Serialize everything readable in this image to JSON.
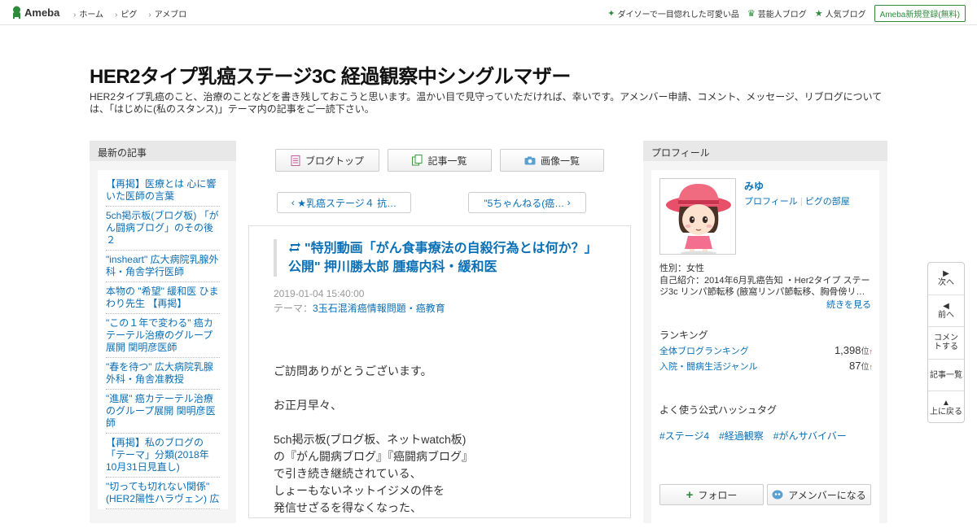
{
  "topbar": {
    "logo": "Ameba",
    "nav": [
      "ホーム",
      "ピグ",
      "アメブロ"
    ],
    "links": [
      {
        "icon": "sparkle-icon",
        "label": "ダイソーで一目惚れした可愛い品"
      },
      {
        "icon": "crown-icon",
        "label": "芸能人ブログ"
      },
      {
        "icon": "star-icon",
        "label": "人気ブログ"
      }
    ],
    "register": "Ameba新規登録(無料)"
  },
  "blog": {
    "title": "HER2タイプ乳癌ステージ3C 経過観察中シングルマザー",
    "description": "HER2タイプ乳癌のこと、治療のことなどを書き残しておこうと思います。温かい目で見守っていただければ、幸いです。アメンバー申請、コメント、メッセージ、リブログについては、「はじめに(私のスタンス)」テーマ内の記事をご一読下さい。"
  },
  "left": {
    "heading": "最新の記事",
    "items": [
      "【再掲】医療とは 心に響いた医師の言葉",
      "5ch掲示板(ブログ板) 「がん闘病ブログ」のその後２",
      "\"insheart\" 広大病院乳腺外科・角舎学行医師",
      "本物の \"希望\" 緩和医 ひまわり先生 【再掲】",
      "\"この１年で変わる\" 癌カテーテル治療のグループ展開 関明彦医師",
      "\"春を待つ\" 広大病院乳腺外科・角舎准教授",
      "\"進展\" 癌カテーテル治療のグループ展開 関明彦医師",
      "【再掲】私のブログの「テーマ」分類(2018年10月31日見直し)",
      "\"切っても切れない関係\" (HER2陽性ハラヴェン) 広"
    ]
  },
  "center": {
    "buttons": [
      "ブログトップ",
      "記事一覧",
      "画像一覧"
    ],
    "prev": "★乳癌ステージ４ 抗…",
    "next": "\"5ちゃんねる(癌…",
    "article": {
      "title": "\"特別動画「がん食事療法の自殺行為とは何か？」公開\" 押川勝太郎 腫瘍内科・緩和医",
      "date": "2019-01-04 15:40:00",
      "theme_label": "テーマ：",
      "theme": "3玉石混淆癌情報問題・癌教育",
      "body": [
        "ご訪問ありがとうございます。",
        "",
        "お正月早々、",
        "",
        "5ch掲示板(ブログ板、ネットwatch板)",
        "の『がん闘病ブログ』『癌闘病ブログ』",
        "で引き続き継続されている、",
        "しょーもないネットイジメの件を",
        "発信せざるを得なくなった、"
      ]
    }
  },
  "right": {
    "heading": "プロフィール",
    "name": "みゆ",
    "link_profile": "プロフィール",
    "link_room": "ピグの部屋",
    "gender": "性別：女性",
    "intro": "自己紹介：2014年6月乳癌告知 ・Her2タイプ ステージ3c リンパ節転移 (腋窩リンパ節転移、胸骨傍リ…",
    "more": "続きを見る",
    "ranking_heading": "ランキング",
    "rankings": [
      {
        "label": "全体ブログランキング",
        "value": "1,398",
        "unit": "位",
        "arrow": "↑"
      },
      {
        "label": "入院・闘病生活ジャンル",
        "value": "87",
        "unit": "位",
        "arrow": "↑"
      }
    ],
    "hashtag_heading": "よく使う公式ハッシュタグ",
    "hashtags": [
      "#ステージ4",
      "#経過観察",
      "#がんサバイバー"
    ],
    "follow": "フォロー",
    "amember": "アメンバーになる"
  },
  "sidenav": [
    {
      "icon": "play-right-icon",
      "label": "次へ"
    },
    {
      "icon": "play-left-icon",
      "label": "前へ"
    },
    {
      "icon": "",
      "label": "コメントする"
    },
    {
      "icon": "",
      "label": "記事一覧"
    },
    {
      "icon": "triangle-up-icon",
      "label": "上に戻る"
    }
  ],
  "colors": {
    "brand": "#2d8c3c",
    "link": "#0a6fb5",
    "panel": "#f5f5f5"
  }
}
